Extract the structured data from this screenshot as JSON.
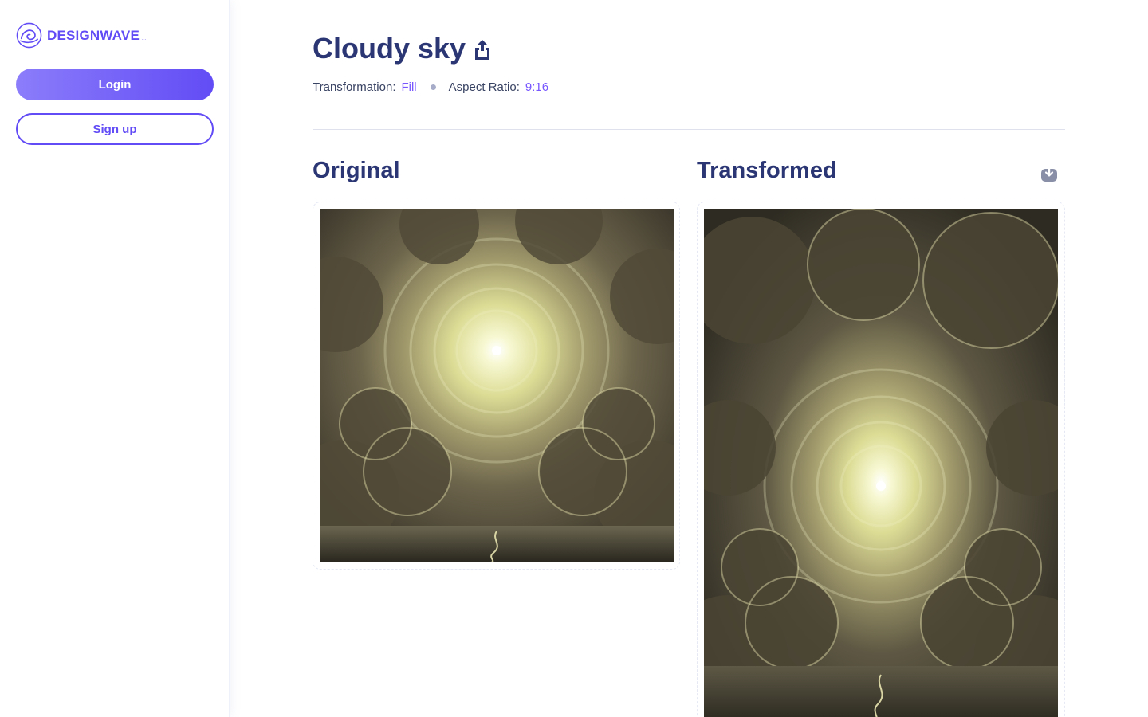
{
  "brand": {
    "name": "DESIGNWAVE",
    "suffix": "..."
  },
  "sidebar": {
    "login_label": "Login",
    "signup_label": "Sign up"
  },
  "page": {
    "title": "Cloudy sky",
    "meta": {
      "transformation_label": "Transformation:",
      "transformation_value": "Fill",
      "aspect_label": "Aspect Ratio:",
      "aspect_value": "9:16"
    }
  },
  "sections": {
    "original_title": "Original",
    "transformed_title": "Transformed"
  },
  "icons": {
    "share": "share-icon",
    "download": "download-icon",
    "logo": "wave-logo-icon"
  },
  "colors": {
    "accent": "#624cf5",
    "heading": "#2b3674",
    "sky_dark": "#2e2b22",
    "sky_light": "#eef0b0"
  }
}
